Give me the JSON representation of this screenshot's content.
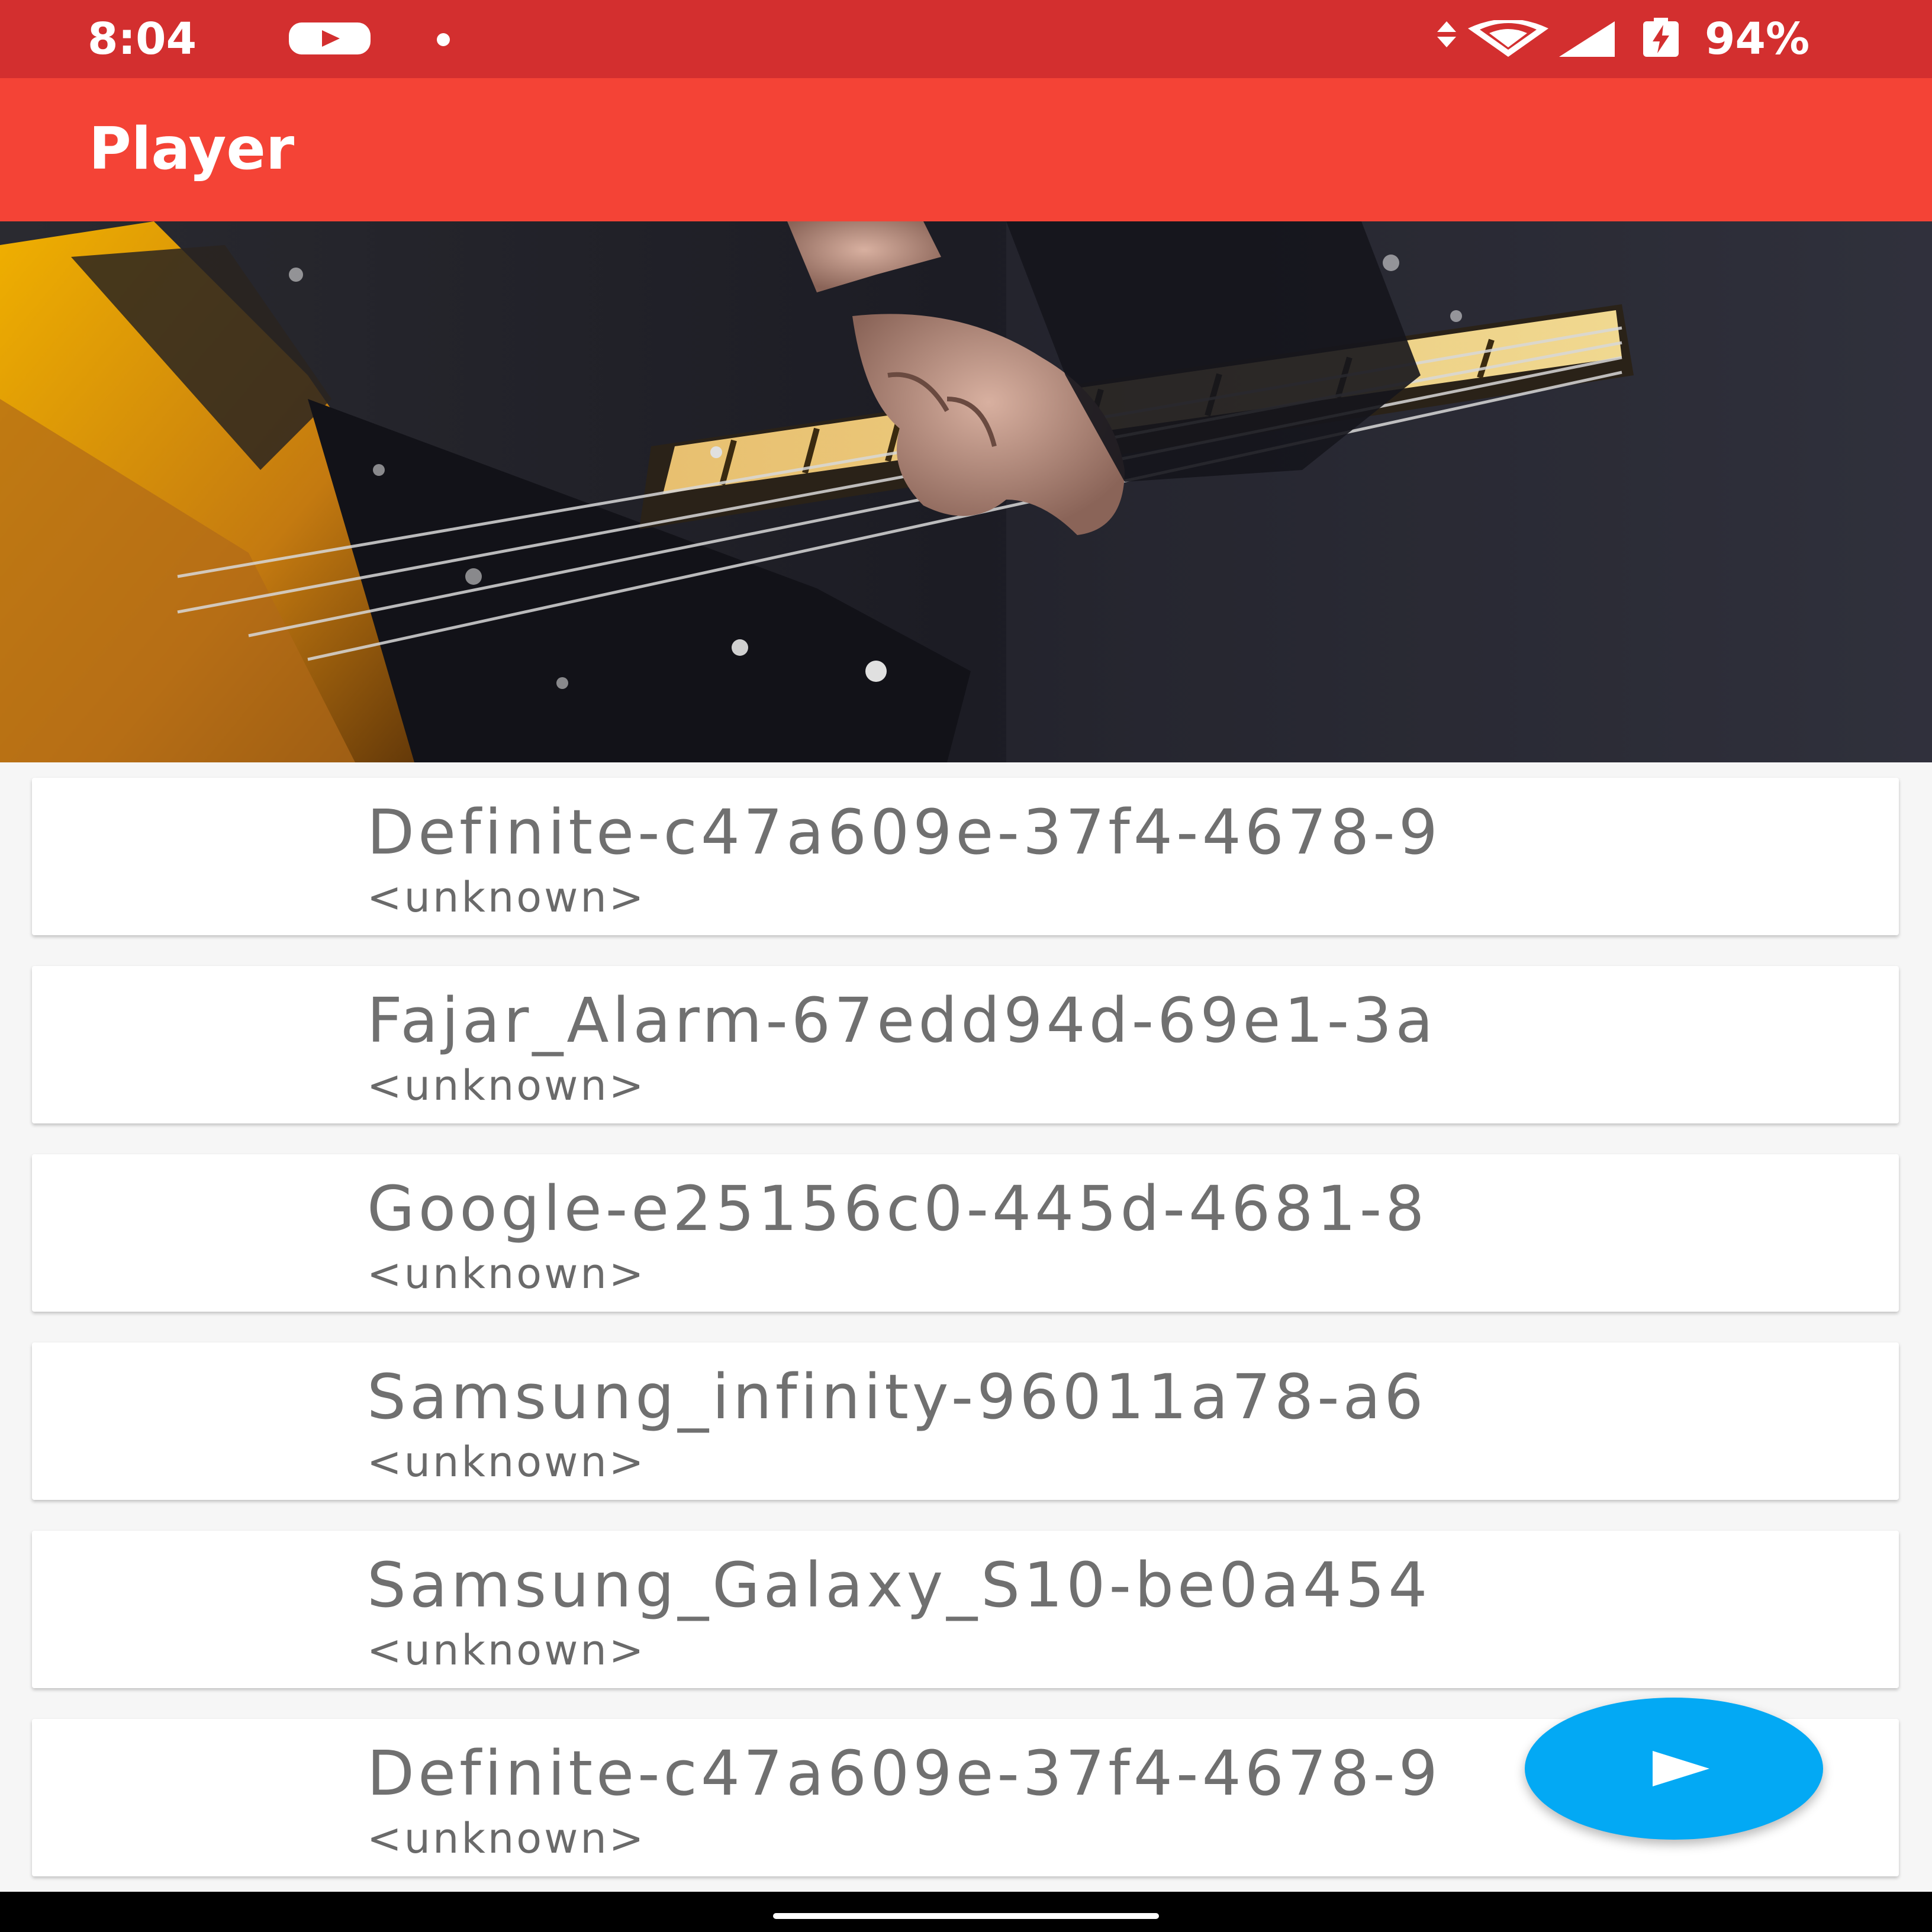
{
  "status_bar": {
    "time": "8:04",
    "battery": "94%",
    "icons": [
      "youtube-icon",
      "notification-dot-icon",
      "data-arrows-icon",
      "wifi-icon",
      "cell-signal-icon",
      "battery-charging-icon"
    ]
  },
  "app_bar": {
    "title": "Player"
  },
  "header_image": {
    "subject": "bass guitar fretboard with hand"
  },
  "songs": [
    {
      "title": "Definite-c47a609e-37f4-4678-9",
      "artist": "<unknown>"
    },
    {
      "title": "Fajar_Alarm-67edd94d-69e1-3a",
      "artist": "<unknown>"
    },
    {
      "title": "Google-e25156c0-445d-4681-8",
      "artist": "<unknown>"
    },
    {
      "title": "Samsung_infinity-96011a78-a6",
      "artist": "<unknown>"
    },
    {
      "title": "Samsung_Galaxy_S10-be0a454",
      "artist": "<unknown>"
    },
    {
      "title": "Definite-c47a609e-37f4-4678-9",
      "artist": "<unknown>"
    }
  ],
  "fab": {
    "icon": "play-icon"
  },
  "colors": {
    "status_bar": "#d32f2f",
    "app_bar": "#f44336",
    "fab": "#03a9f4"
  }
}
